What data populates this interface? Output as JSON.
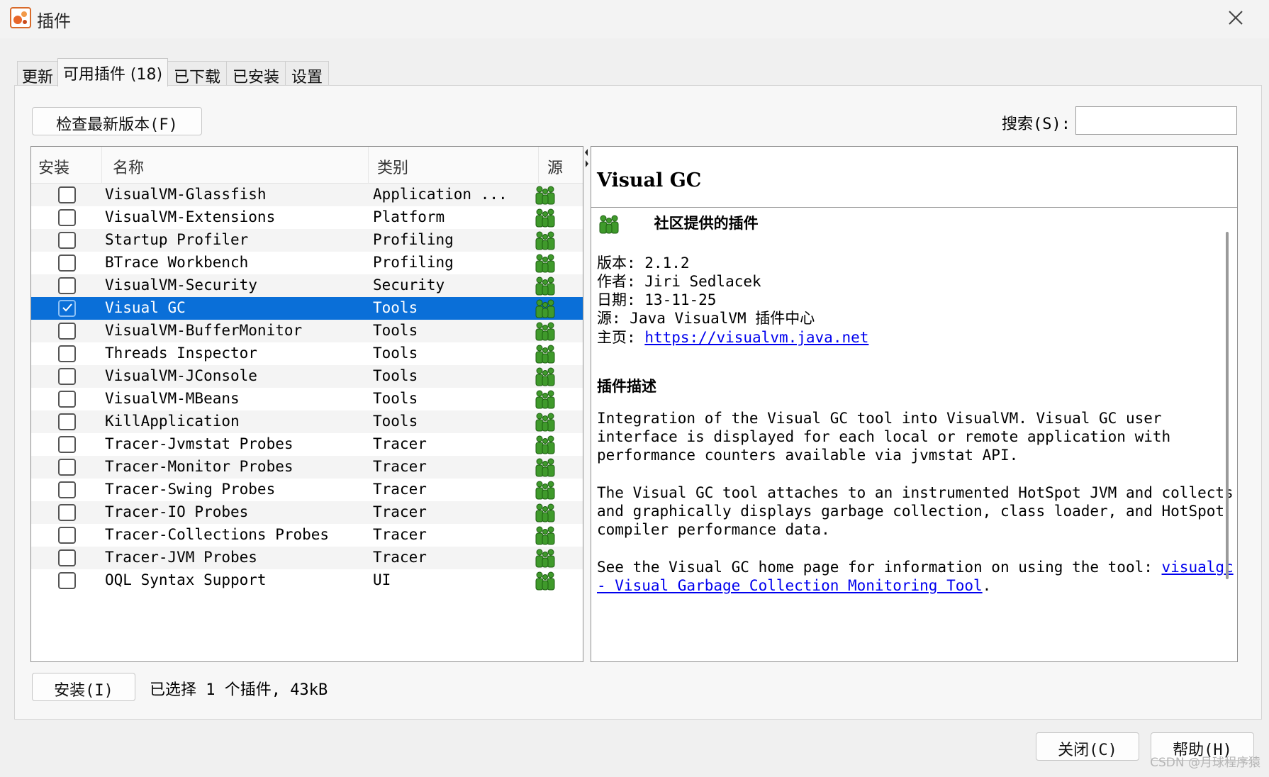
{
  "window": {
    "title": "插件",
    "watermark": "CSDN @月球程序猿"
  },
  "tabs": [
    {
      "label": "更新"
    },
    {
      "label": "可用插件 (18)"
    },
    {
      "label": "已下载"
    },
    {
      "label": "已安装"
    },
    {
      "label": "设置"
    }
  ],
  "toolbar": {
    "check_label": "检查最新版本(F)",
    "search_label": "搜索(S):",
    "search_value": ""
  },
  "table": {
    "headers": [
      "安装",
      "名称",
      "类别",
      "源"
    ],
    "rows": [
      {
        "checked": false,
        "name": "VisualVM-Glassfish",
        "category": "Application ..."
      },
      {
        "checked": false,
        "name": "VisualVM-Extensions",
        "category": "Platform"
      },
      {
        "checked": false,
        "name": "Startup Profiler",
        "category": "Profiling"
      },
      {
        "checked": false,
        "name": "BTrace Workbench",
        "category": "Profiling"
      },
      {
        "checked": false,
        "name": "VisualVM-Security",
        "category": "Security"
      },
      {
        "checked": true,
        "name": "Visual GC",
        "category": "Tools"
      },
      {
        "checked": false,
        "name": "VisualVM-BufferMonitor",
        "category": "Tools"
      },
      {
        "checked": false,
        "name": "Threads Inspector",
        "category": "Tools"
      },
      {
        "checked": false,
        "name": "VisualVM-JConsole",
        "category": "Tools"
      },
      {
        "checked": false,
        "name": "VisualVM-MBeans",
        "category": "Tools"
      },
      {
        "checked": false,
        "name": "KillApplication",
        "category": "Tools"
      },
      {
        "checked": false,
        "name": "Tracer-Jvmstat Probes",
        "category": "Tracer"
      },
      {
        "checked": false,
        "name": "Tracer-Monitor Probes",
        "category": "Tracer"
      },
      {
        "checked": false,
        "name": "Tracer-Swing Probes",
        "category": "Tracer"
      },
      {
        "checked": false,
        "name": "Tracer-IO Probes",
        "category": "Tracer"
      },
      {
        "checked": false,
        "name": "Tracer-Collections Probes",
        "category": "Tracer"
      },
      {
        "checked": false,
        "name": "Tracer-JVM Probes",
        "category": "Tracer"
      },
      {
        "checked": false,
        "name": "OQL Syntax Support",
        "category": "UI"
      }
    ]
  },
  "detail": {
    "title": "Visual GC",
    "community_label": "社区提供的插件",
    "version": "版本: 2.1.2",
    "author": "作者: Jiri Sedlacek",
    "date": "日期: 13-11-25",
    "source": "源: Java VisualVM 插件中心",
    "homepage_label": "主页:",
    "homepage_url": "https://visualvm.java.net",
    "desc_heading": "插件描述",
    "para1": [
      "Integration of the Visual GC tool into VisualVM. Visual GC user",
      "interface is displayed for each local or remote application with",
      "performance counters available via jvmstat API."
    ],
    "para2": [
      "The Visual GC tool attaches to an instrumented HotSpot JVM and collects",
      "and graphically displays garbage collection, class loader, and HotSpot",
      "compiler performance data."
    ],
    "para3_text": "See the Visual GC home page for information on using the tool: ",
    "para3_link1": "visualgc",
    "para3_link2": "- Visual Garbage Collection Monitoring Tool",
    "para3_end": "."
  },
  "footer": {
    "install_label": "安装(I)",
    "status": "已选择 1 个插件, 43kB",
    "close_label": "关闭(C)",
    "help_label": "帮助(H)"
  }
}
